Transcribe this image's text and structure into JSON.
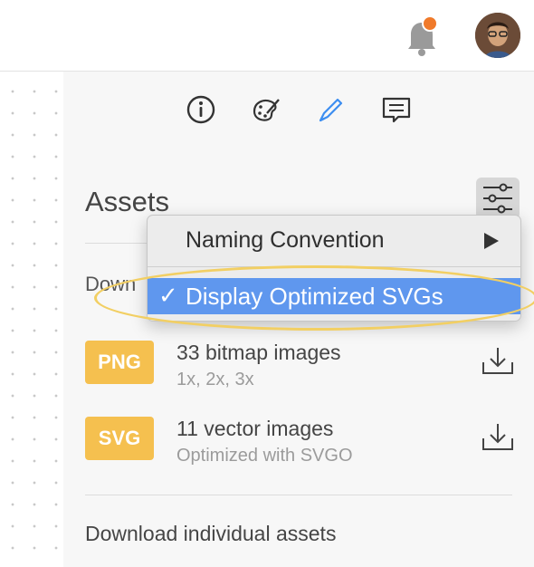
{
  "header": {
    "notification_badge_color": "#f07a2a",
    "icons": [
      "bell-icon",
      "avatar"
    ]
  },
  "inspector": {
    "tabs": [
      {
        "icon": "info-icon"
      },
      {
        "icon": "palette-icon"
      },
      {
        "icon": "pen-icon",
        "active": true
      },
      {
        "icon": "comment-icon"
      }
    ],
    "accent_color": "#3d8ef0"
  },
  "assets": {
    "title": "Assets",
    "download_label_truncated": "Down",
    "rows": [
      {
        "badge": "PNG",
        "title": "33 bitmap images",
        "subtitle": "1x, 2x, 3x"
      },
      {
        "badge": "SVG",
        "title": "11 vector images",
        "subtitle": "Optimized with SVGO"
      }
    ],
    "individual_label": "Download individual assets",
    "badge_color": "#f5c04f"
  },
  "menu": {
    "items": [
      {
        "label": "Naming Convention",
        "submenu": true
      },
      {
        "label": "Display Optimized SVGs",
        "checked": true,
        "selected": true
      }
    ],
    "check_glyph": "✓",
    "selected_color": "#5f97ee"
  }
}
